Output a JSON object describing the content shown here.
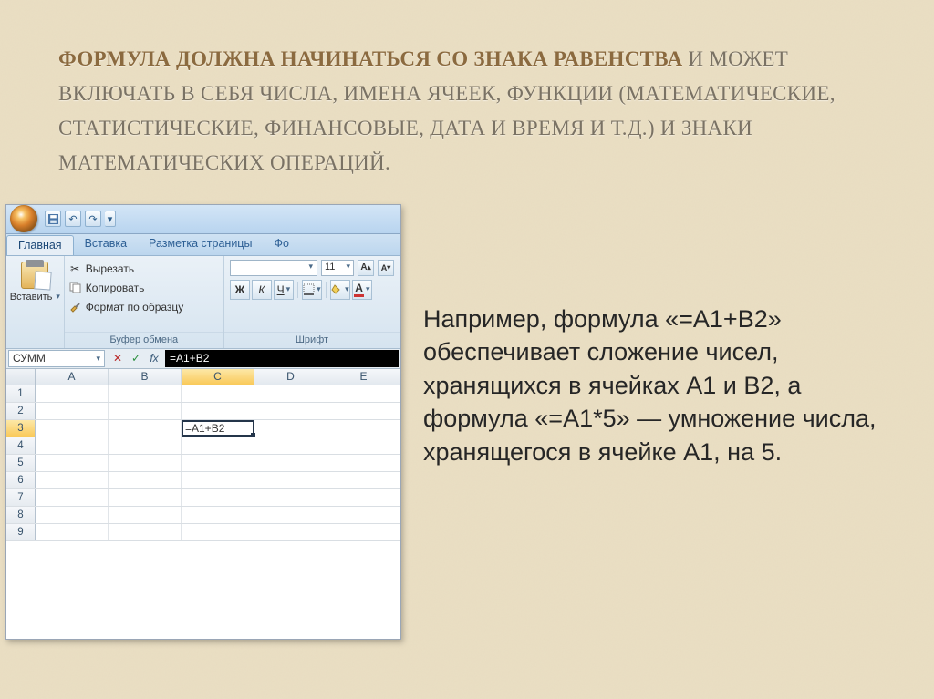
{
  "heading": {
    "strong": "ФОРМУЛА ДОЛЖНА НАЧИНАТЬСЯ СО ЗНАКА РАВЕНСТВА",
    "rest": " И МОЖЕТ ВКЛЮЧАТЬ В СЕБЯ ЧИСЛА, ИМЕНА ЯЧЕЕК, ФУНКЦИИ (МАТЕМАТИЧЕСКИЕ, СТАТИСТИЧЕСКИЕ, ФИНАНСОВЫЕ, ДАТА И ВРЕМЯ И Т.Д.) И ЗНАКИ МАТЕМАТИЧЕСКИХ ОПЕРАЦИЙ."
  },
  "excel": {
    "tabs": {
      "home": "Главная",
      "insert": "Вставка",
      "page_layout": "Разметка страницы",
      "partial": "Фо"
    },
    "clipboard": {
      "paste": "Вставить",
      "cut": "Вырезать",
      "copy": "Копировать",
      "format_painter": "Формат по образцу",
      "group": "Буфер обмена"
    },
    "font": {
      "size": "11",
      "bold": "Ж",
      "italic": "К",
      "underline": "Ч",
      "group": "Шрифт",
      "grow": "A",
      "shrink": "A"
    },
    "formula_bar": {
      "name_box": "СУММ",
      "formula": "=A1+B2",
      "fx": "fx"
    },
    "columns": [
      "A",
      "B",
      "C",
      "D",
      "E"
    ],
    "rows": [
      "1",
      "2",
      "3",
      "4",
      "5",
      "6",
      "7",
      "8",
      "9"
    ],
    "active_cell": {
      "row": 3,
      "col": "C",
      "value": "=A1+B2"
    }
  },
  "body_text": "   Например, формула «=А1+В2» обеспечивает сложение чисел, хранящихся в ячейках А1 и В2, а формула «=А1*5» — умножение числа, хранящегося в ячейке А1, на 5."
}
